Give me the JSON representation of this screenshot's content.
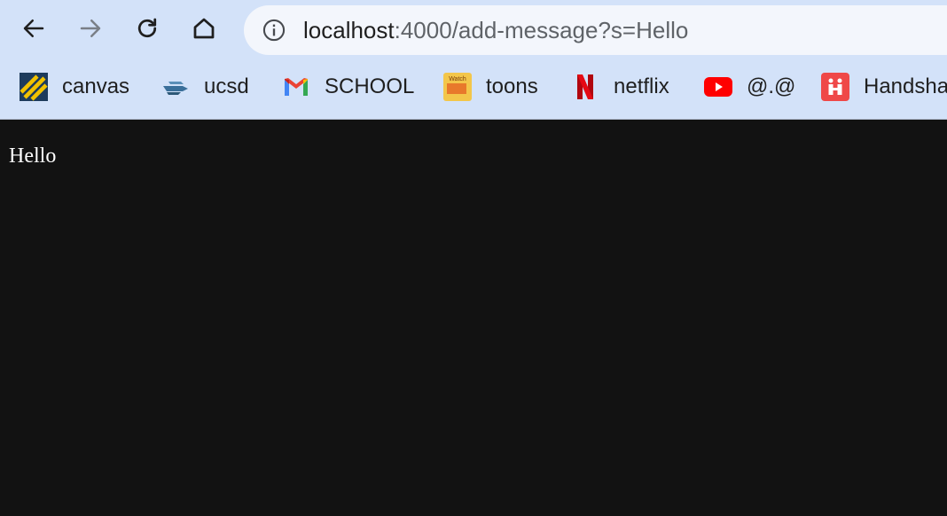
{
  "toolbar": {
    "back_icon": "arrow-left-icon",
    "forward_icon": "arrow-right-icon",
    "reload_icon": "reload-icon",
    "home_icon": "home-icon",
    "site_info_icon": "info-icon"
  },
  "address_bar": {
    "host": "localhost",
    "rest": ":4000/add-message?s=Hello"
  },
  "bookmarks": [
    {
      "label": "canvas",
      "icon": "canvas-logo-icon"
    },
    {
      "label": "ucsd",
      "icon": "ucsd-logo-icon"
    },
    {
      "label": "SCHOOL",
      "icon": "gmail-icon"
    },
    {
      "label": "toons",
      "icon": "watch-anime-icon"
    },
    {
      "label": "netflix",
      "icon": "netflix-icon"
    },
    {
      "label": "@.@",
      "icon": "youtube-icon"
    },
    {
      "label": "Handshake",
      "icon": "handshake-icon"
    }
  ],
  "page": {
    "message": "Hello"
  },
  "colors": {
    "chrome_bg": "#d3e2f9",
    "omnibox_bg": "#f3f6fc",
    "page_bg": "#121212",
    "page_text": "#ffffff"
  }
}
